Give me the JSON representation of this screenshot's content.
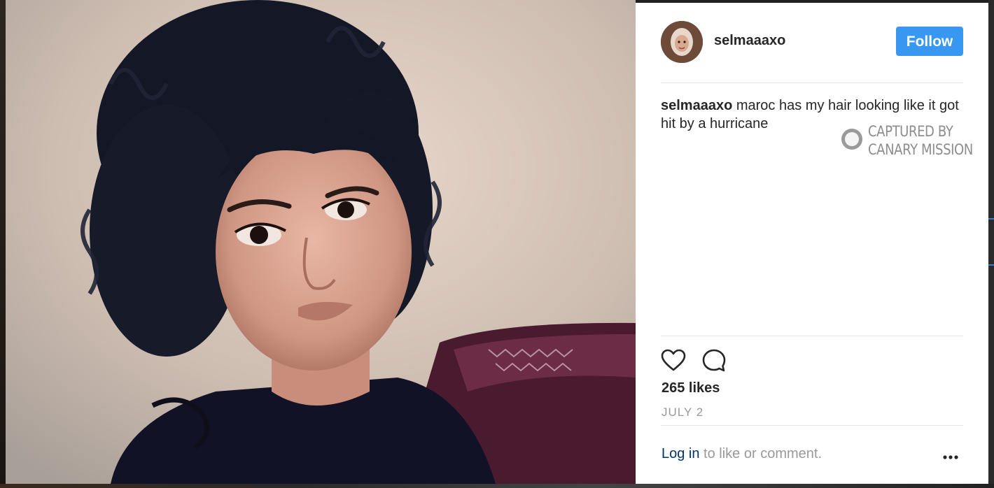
{
  "post": {
    "username": "selmaaaxo",
    "follow_label": "Follow",
    "caption_user": "selmaaaxo",
    "caption_text": " maroc has my hair looking like it got hit by a hurricane",
    "likes": "265 likes",
    "date": "JULY 2",
    "login_link": "Log in",
    "login_suffix": " to like or comment."
  },
  "watermark": {
    "line1": "CAPTURED BY",
    "line2": "CANARY MISSION"
  },
  "icons": {
    "like": "heart-icon",
    "comment": "comment-icon",
    "more": "more-options-icon",
    "watermark": "canary-mission-logo"
  },
  "colors": {
    "follow_button": "#3897f0",
    "text": "#262626",
    "muted": "#999999",
    "link": "#003569"
  }
}
